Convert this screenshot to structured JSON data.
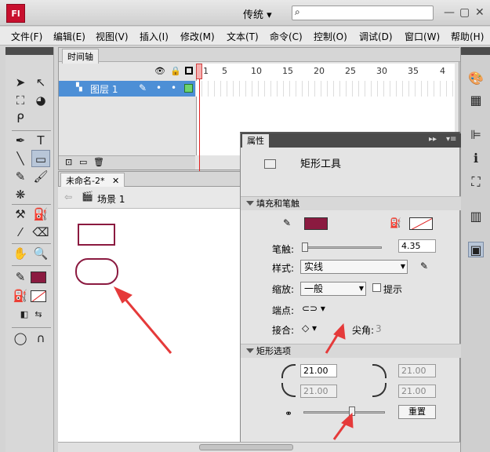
{
  "app": {
    "logo": "Fl",
    "workspace": "传统",
    "search_placeholder": ""
  },
  "menu": [
    "文件(F)",
    "编辑(E)",
    "视图(V)",
    "插入(I)",
    "修改(M)",
    "文本(T)",
    "命令(C)",
    "控制(O)",
    "调试(D)",
    "窗口(W)",
    "帮助(H)"
  ],
  "timeline": {
    "tab": "时间轴",
    "layer_name": "图层 1",
    "frame_numbers": [
      "1",
      "5",
      "10",
      "15",
      "20",
      "25",
      "30",
      "35",
      "4"
    ]
  },
  "document": {
    "tab": "未命名-2*",
    "scene": "场景 1"
  },
  "properties": {
    "tab": "属性",
    "tool_name": "矩形工具",
    "fill_stroke_title": "填充和笔触",
    "stroke_label": "笔触:",
    "stroke_value": "4.35",
    "style_label": "样式:",
    "style_value": "实线",
    "scale_label": "缩放:",
    "scale_value": "一般",
    "hint_label": "提示",
    "cap_label": "端点:",
    "join_label": "接合:",
    "miter_label": "尖角:",
    "miter_value": "3",
    "rect_options_title": "矩形选项",
    "corner_tl": "21.00",
    "corner_tr": "21.00",
    "corner_bl": "21.00",
    "corner_br": "21.00",
    "reset_label": "重置"
  },
  "colors": {
    "stroke": "#8b1a40",
    "fill": "#8b1a40",
    "accent_arrow": "#e53a3a"
  }
}
